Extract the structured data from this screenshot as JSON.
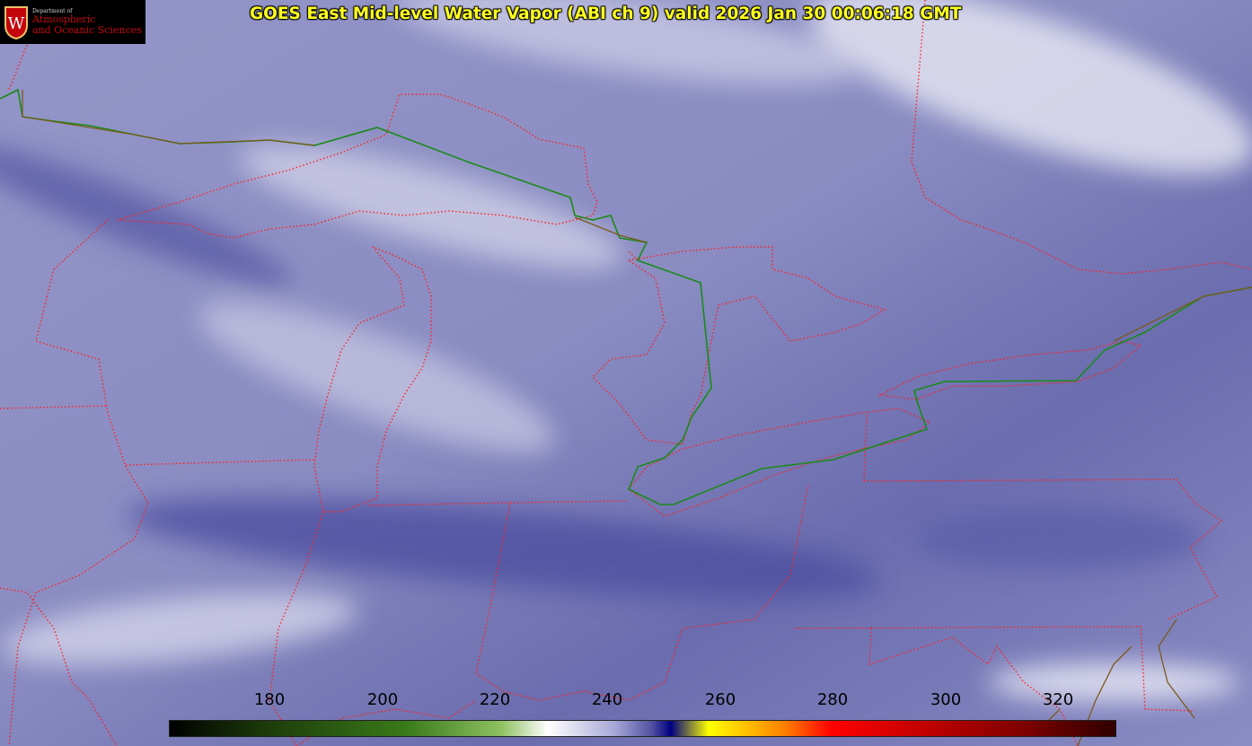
{
  "logo": {
    "dept": "Department of",
    "line1": "Atmospheric",
    "line2": "and Oceanic Sciences",
    "shield_letter": "W"
  },
  "title": "GOES East Mid-level Water Vapor (ABI ch 9)  valid 2026 Jan 30 00:06:18 GMT",
  "colorbar": {
    "ticks": [
      "180",
      "200",
      "220",
      "240",
      "260",
      "280",
      "300",
      "320"
    ],
    "stops": [
      "#000000",
      "#1c3a0a",
      "#3a7a1a",
      "#8ec060",
      "#ffffff",
      "#a8a8d8",
      "#5050a0",
      "#000080",
      "#ffff00",
      "#ff8000",
      "#ff0000",
      "#c00000",
      "#800000",
      "#300000"
    ]
  },
  "colors": {
    "state_borders": "#ff2020",
    "international_border": "#1a8a1a",
    "coastline": "#7a5a1a"
  }
}
